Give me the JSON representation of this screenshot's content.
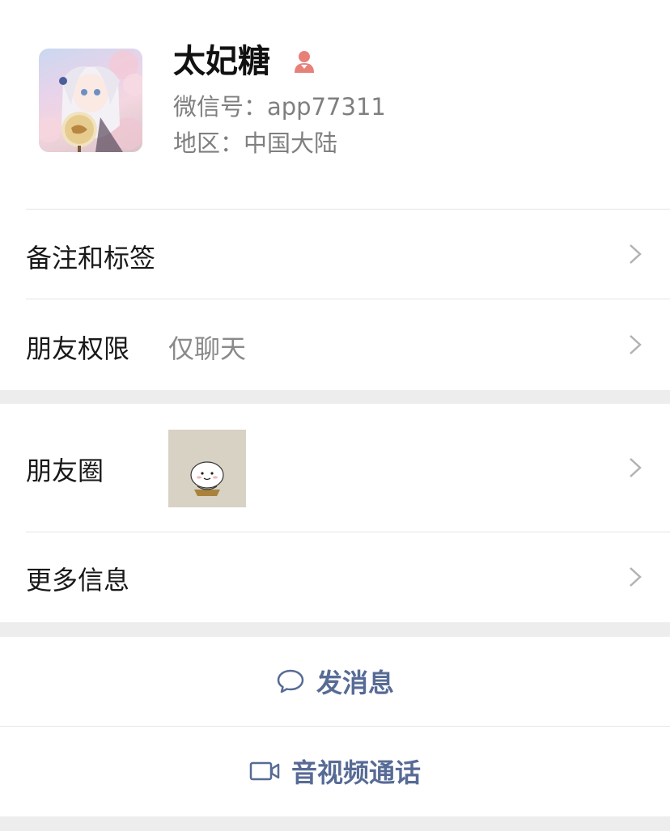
{
  "profile": {
    "name": "太妃糖",
    "wechat_id_line": "微信号：app77311",
    "region_line": "地区：中国大陆",
    "gender_icon": "female-icon",
    "gender_color": "#e8807a"
  },
  "settings": {
    "remark_label": "备注和标签",
    "permission_label": "朋友权限",
    "permission_value": "仅聊天"
  },
  "moments": {
    "label": "朋友圈",
    "more_info_label": "更多信息"
  },
  "actions": {
    "message_label": "发消息",
    "call_label": "音视频通话",
    "accent_color": "#576b95"
  }
}
